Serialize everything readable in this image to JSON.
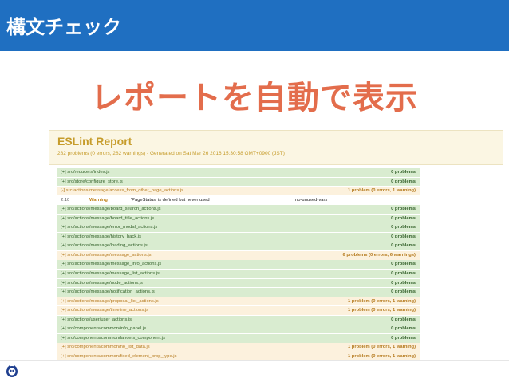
{
  "slide": {
    "section_title": "構文チェック",
    "headline": "レポートを自動で表示"
  },
  "report": {
    "title": "ESLint Report",
    "subtitle": "282 problems (0 errors, 282 warnings) - Generated on Sat Mar 26 2016 15:30:58 GMT+0900 (JST)",
    "rows": [
      {
        "kind": "ok",
        "path": "[+] src/reducers/index.js",
        "count": "0 problems"
      },
      {
        "kind": "ok",
        "path": "[+] src/store/configure_store.js",
        "count": "0 problems"
      },
      {
        "kind": "warn",
        "path": "[-] src/actions/message/access_from_other_page_actions.js",
        "count": "1 problem (0 errors, 1 warning)"
      },
      {
        "kind": "msg",
        "loc": "2:10",
        "severity": "Warning",
        "text": "'PageStatus' is defined but never used",
        "rule": "no-unused-vars"
      },
      {
        "kind": "ok",
        "path": "[+] src/actions/message/board_search_actions.js",
        "count": "0 problems"
      },
      {
        "kind": "ok",
        "path": "[+] src/actions/message/board_title_actions.js",
        "count": "0 problems"
      },
      {
        "kind": "ok",
        "path": "[+] src/actions/message/error_modal_actions.js",
        "count": "0 problems"
      },
      {
        "kind": "ok",
        "path": "[+] src/actions/message/history_back.js",
        "count": "0 problems"
      },
      {
        "kind": "ok",
        "path": "[+] src/actions/message/loading_actions.js",
        "count": "0 problems"
      },
      {
        "kind": "warn",
        "path": "[+] src/actions/message/message_actions.js",
        "count": "6 problems (0 errors, 6 warnings)"
      },
      {
        "kind": "ok",
        "path": "[+] src/actions/message/message_info_actions.js",
        "count": "0 problems"
      },
      {
        "kind": "ok",
        "path": "[+] src/actions/message/message_list_actions.js",
        "count": "0 problems"
      },
      {
        "kind": "ok",
        "path": "[+] src/actions/message/node_actions.js",
        "count": "0 problems"
      },
      {
        "kind": "ok",
        "path": "[+] src/actions/message/notification_actions.js",
        "count": "0 problems"
      },
      {
        "kind": "warn",
        "path": "[+] src/actions/message/proposal_list_actions.js",
        "count": "1 problem (0 errors, 1 warning)"
      },
      {
        "kind": "warn",
        "path": "[+] src/actions/message/timeline_actions.js",
        "count": "1 problem (0 errors, 1 warning)"
      },
      {
        "kind": "ok",
        "path": "[+] src/actions/user/user_actions.js",
        "count": "0 problems"
      },
      {
        "kind": "ok",
        "path": "[+] src/components/common/info_panel.js",
        "count": "0 problems"
      },
      {
        "kind": "ok",
        "path": "[+] src/components/common/lancers_component.js",
        "count": "0 problems"
      },
      {
        "kind": "warn",
        "path": "[+] src/components/common/no_list_data.js",
        "count": "1 problem (0 errors, 1 warning)"
      },
      {
        "kind": "warn",
        "path": "[+] src/components/common/fixed_element_prop_type.js",
        "count": "1 problem (0 errors, 1 warning)"
      }
    ]
  },
  "colors": {
    "header_bar": "#1f6fc1",
    "headline": "#e36d4c",
    "ok_row": "#d9ecd0",
    "warn_row": "#fcf1dd",
    "report_title": "#c69c2b"
  },
  "icons": {
    "logo": "mascot-logo-icon"
  }
}
